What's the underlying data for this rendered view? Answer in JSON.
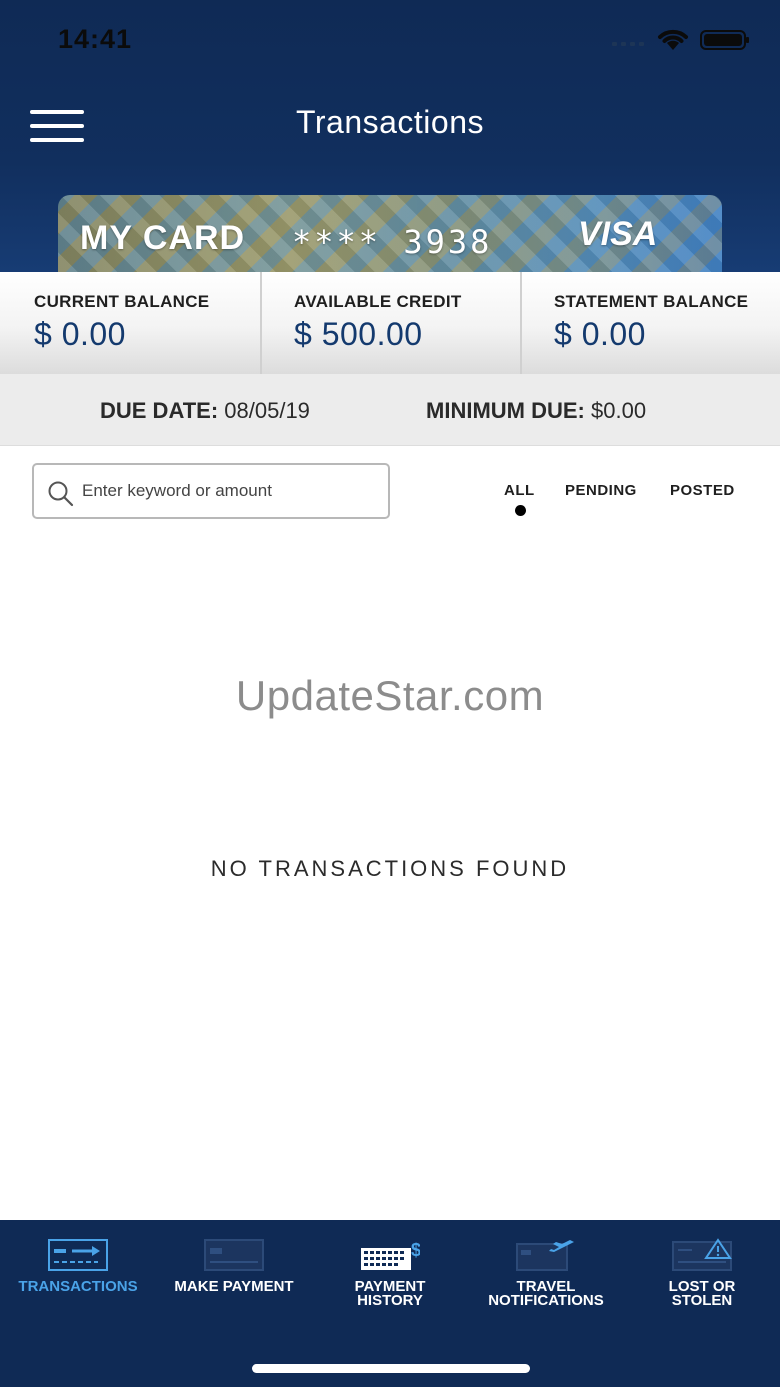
{
  "status_bar": {
    "time": "14:41"
  },
  "header": {
    "title": "Transactions"
  },
  "card": {
    "name": "MY CARD",
    "number": "**** 3938",
    "brand": "VISA"
  },
  "balances": [
    {
      "label": "CURRENT BALANCE",
      "value": "$ 0.00"
    },
    {
      "label": "AVAILABLE CREDIT",
      "value": "$ 500.00"
    },
    {
      "label": "STATEMENT BALANCE",
      "value": "$ 0.00"
    }
  ],
  "due": {
    "date_label": "DUE DATE:",
    "date_value": "08/05/19",
    "min_label": "MINIMUM DUE:",
    "min_value": "$0.00"
  },
  "search": {
    "placeholder": "Enter keyword or amount"
  },
  "filters": {
    "all": "ALL",
    "pending": "PENDING",
    "posted": "POSTED",
    "active": "ALL"
  },
  "watermark": "UpdateStar.com",
  "empty_message": "NO TRANSACTIONS FOUND",
  "nav": [
    {
      "label": "TRANSACTIONS",
      "icon": "transactions-icon",
      "active": true
    },
    {
      "label": "MAKE PAYMENT",
      "icon": "card-icon",
      "active": false
    },
    {
      "label": "PAYMENT HISTORY",
      "icon": "calendar-dollar-icon",
      "active": false
    },
    {
      "label": "TRAVEL NOTIFICATIONS",
      "icon": "card-plane-icon",
      "active": false
    },
    {
      "label": "LOST OR STOLEN",
      "icon": "card-warning-icon",
      "active": false
    }
  ],
  "colors": {
    "navy": "#0f2a55",
    "balance_blue": "#143a6e",
    "active_nav": "#4aa3e8"
  }
}
